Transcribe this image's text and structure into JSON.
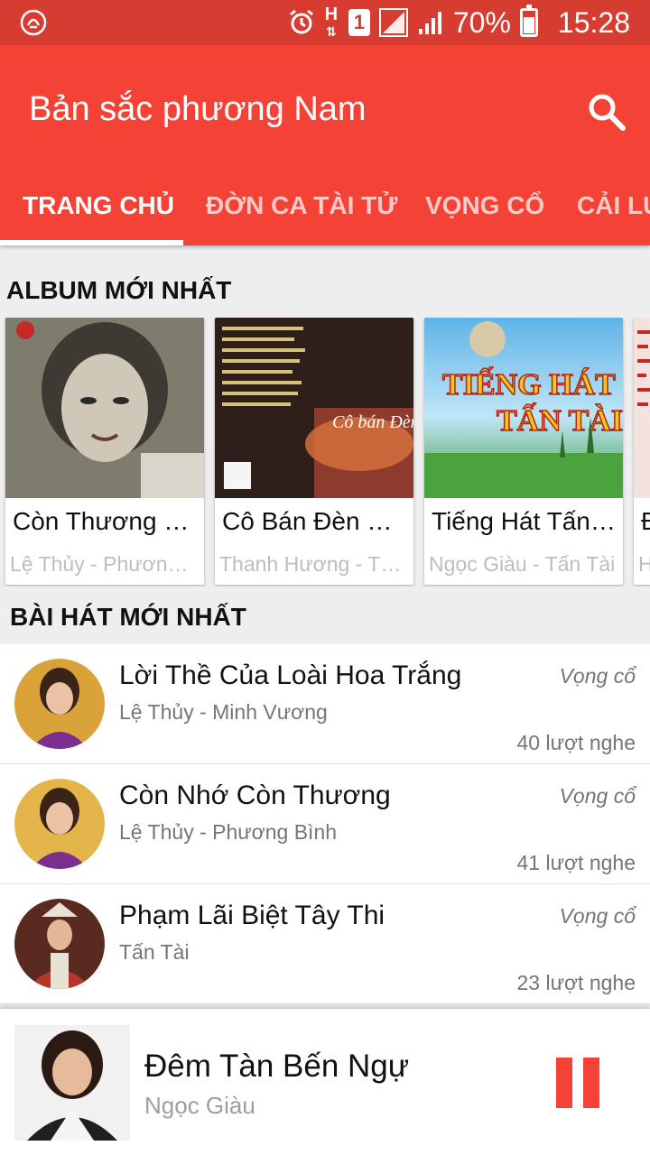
{
  "status_bar": {
    "network_label": "H",
    "sim": "1",
    "battery": "70%",
    "battery_level": 0.7,
    "time": "15:28"
  },
  "app_bar": {
    "title": "Bản sắc phương Nam",
    "search_icon": "search-icon",
    "tabs": [
      {
        "label": "TRANG CHỦ",
        "active": true
      },
      {
        "label": "ĐỜN CA TÀI TỬ",
        "active": false
      },
      {
        "label": "VỌNG CỔ",
        "active": false
      },
      {
        "label": "CẢI LƯƠNG",
        "active": false
      }
    ]
  },
  "albums_section": {
    "title": "ALBUM MỚI NHẤT",
    "items": [
      {
        "title": "Còn Thương Rau Đắng Mọc Sau Hè",
        "artist": "Lệ Thủy - Phương Bình"
      },
      {
        "title": "Cô Bán Đèn Hoa Giấy",
        "artist": "Thanh Hương - Thanh Sơn"
      },
      {
        "title": "Tiếng Hát Tấn Tài",
        "artist": "Ngọc Giàu - Tấn Tài"
      },
      {
        "title": "Đ",
        "artist": "H"
      }
    ],
    "cover_texts": {
      "album2_cover": "Cô bán Đèn Hoa giấy",
      "album3_cover_line1": "TIẾNG HÁT",
      "album3_cover_line2": "TẤN TÀI"
    }
  },
  "songs_section": {
    "title": "BÀI HÁT MỚI NHẤT",
    "items": [
      {
        "title": "Lời Thề Của Loài Hoa Trắng",
        "artist": "Lệ Thủy - Minh Vương",
        "genre": "Vọng cổ",
        "plays": "40 lượt nghe"
      },
      {
        "title": "Còn Nhớ Còn Thương",
        "artist": "Lệ Thủy - Phương Bình",
        "genre": "Vọng cổ",
        "plays": "41 lượt nghe"
      },
      {
        "title": "Phạm Lãi Biệt Tây Thi",
        "artist": "Tấn Tài",
        "genre": "Vọng cổ",
        "plays": "23 lượt nghe"
      }
    ]
  },
  "player": {
    "title": "Đêm Tàn Bến Ngự",
    "artist": "Ngọc Giàu",
    "control_icon": "pause-icon"
  },
  "colors": {
    "primary": "#f44336",
    "status_bar": "#d63c2f",
    "background": "#eeeeee"
  }
}
